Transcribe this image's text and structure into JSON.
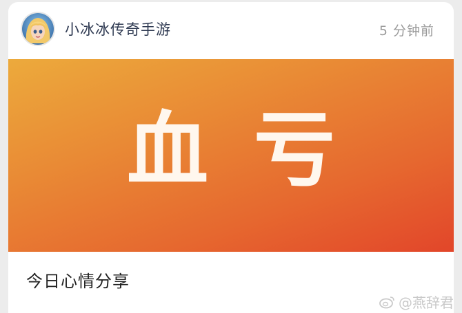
{
  "post": {
    "account_name": "小冰冰传奇手游",
    "time": "5 分钟前",
    "banner_chars": [
      "血",
      "亏"
    ],
    "caption": "今日心情分享"
  },
  "watermark": {
    "text": "@燕辞君",
    "icon": "weibo-icon"
  },
  "colors": {
    "banner_start": "#ecaa3c",
    "banner_end": "#e2462a",
    "name": "#2f3a52",
    "time": "#9a9a9a"
  }
}
